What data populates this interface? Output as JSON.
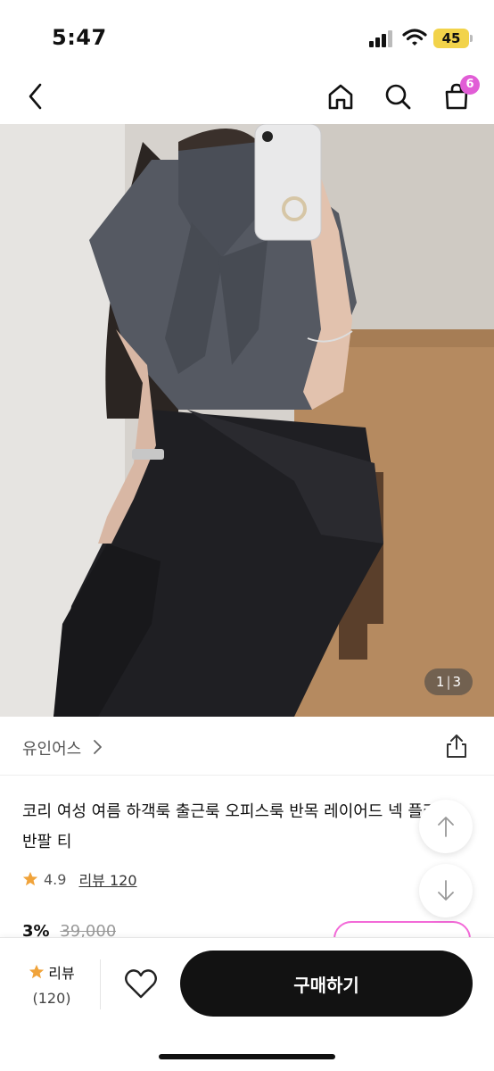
{
  "status": {
    "time": "5:47",
    "battery": "45"
  },
  "nav": {
    "cart_count": "6"
  },
  "image": {
    "counter_current": "1",
    "counter_total": "3"
  },
  "brand": {
    "name": "유인어스"
  },
  "product": {
    "title": "코리 여성 여름 하객룩 출근룩 오피스룩 반목 레이어드 넥 플리츠 반팔 티",
    "rating": "4.9",
    "review_link": "리뷰 120",
    "discount": "3%",
    "original_price": "39,000"
  },
  "bottom": {
    "review_label": "리뷰",
    "review_count": "(120)",
    "buy_label": "구매하기"
  },
  "colors": {
    "accent": "#e15dd6",
    "star": "#f0a33a",
    "buy": "#121212"
  }
}
